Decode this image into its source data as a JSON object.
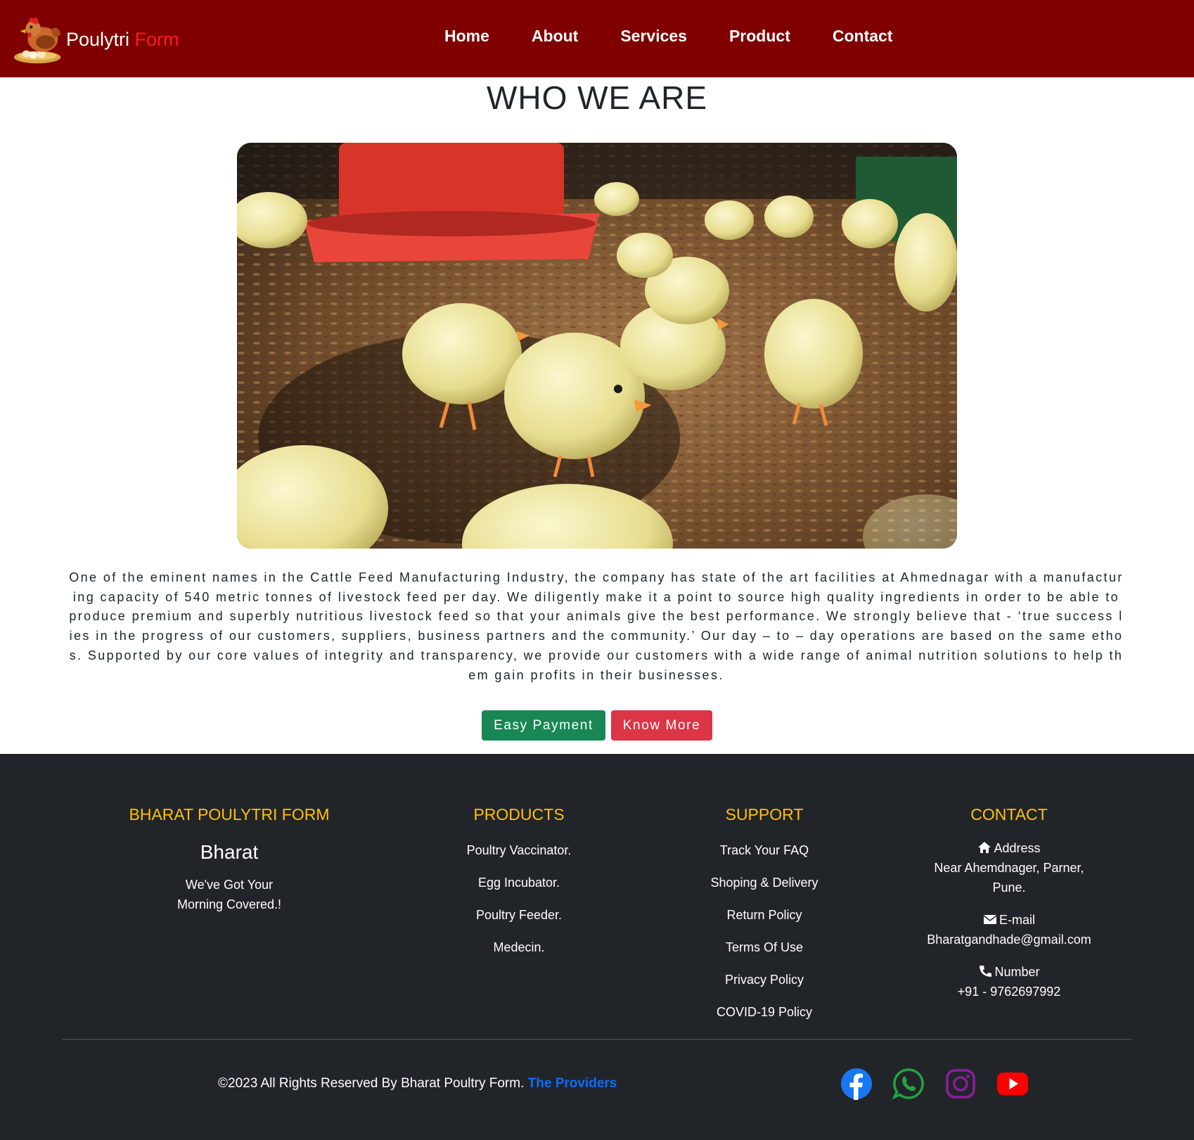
{
  "navbar": {
    "brand_main": "Poulytri ",
    "brand_accent": "Form",
    "links": [
      "Home",
      "About",
      "Services",
      "Product",
      "Contact"
    ]
  },
  "hero": {
    "title": "WHO WE ARE",
    "image_alt": "chicks-photo",
    "text": "One of the eminent names in the Cattle Feed Manufacturing Industry, the company has state of the art facilities at Ahmednagar with a manufacturing capacity of 540 metric tonnes of livestock feed per day. We diligently make it a point to source high quality ingredients in order to be able to produce premium and superbly nutritious livestock feed so that your animals give the best performance. We strongly believe that - ‘true success lies in the progress of our customers, suppliers, business partners and the community.’ Our day – to – day operations are based on the same ethos. Supported by our core values of integrity and transparency, we provide our customers with a wide range of animal nutrition solutions to help them gain profits in their businesses.",
    "btn_payment": "Easy Payment",
    "btn_more": "Know More"
  },
  "footer": {
    "col1": {
      "title": "BHARAT POULYTRI FORM",
      "name": "Bharat",
      "tagline": "We've Got Your Morning Covered.!"
    },
    "col2": {
      "title": "PRODUCTS",
      "items": [
        "Poultry Vaccinator.",
        "Egg Incubator.",
        "Poultry Feeder.",
        "Medecin."
      ]
    },
    "col3": {
      "title": "SUPPORT",
      "items": [
        "Track Your FAQ",
        "Shoping & Delivery",
        "Return Policy",
        "Terms Of Use",
        "Privacy Policy",
        "COVID-19 Policy"
      ]
    },
    "col4": {
      "title": "CONTACT",
      "address_label": "Address",
      "address": "Near Ahemdnager, Parner, Pune.",
      "email_label": "E-mail",
      "email": "Bharatgandhade@gmail.com",
      "phone_label": "Number",
      "phone": "+91 - 9762697992"
    },
    "copyright": "©2023 All Rights Reserved By Bharat Poultry Form. ",
    "copyright_link": "The Providers",
    "social": [
      "facebook-icon",
      "whatsapp-icon",
      "instagram-icon",
      "youtube-icon"
    ]
  },
  "colors": {
    "navbar_bg": "#800000",
    "brand_accent": "#ff1a1a",
    "footer_bg": "#212529",
    "footer_heading": "#ffc107",
    "btn_green": "#198754",
    "btn_red": "#dc3545",
    "link_blue": "#0d6efd",
    "facebook": "#1877f2",
    "whatsapp": "#25d366",
    "instagram": "#8a2be2",
    "youtube": "#ff0000"
  }
}
